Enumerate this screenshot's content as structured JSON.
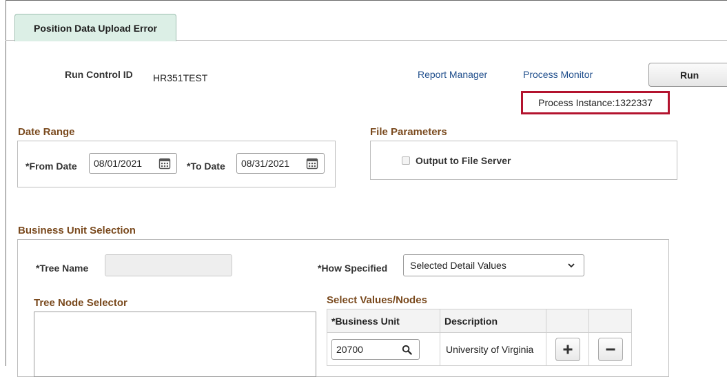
{
  "tab": {
    "label": "Position Data Upload Error"
  },
  "run_control": {
    "label": "Run Control ID",
    "value": "HR351TEST"
  },
  "links": {
    "report_manager": "Report Manager",
    "process_monitor": "Process Monitor"
  },
  "run_button": {
    "label": "Run"
  },
  "process_instance": {
    "text": "Process Instance:1322337"
  },
  "date_range": {
    "title": "Date Range",
    "from_label": "*From Date",
    "from_value": "08/01/2021",
    "to_label": "*To Date",
    "to_value": "08/31/2021"
  },
  "file_parameters": {
    "title": "File Parameters",
    "output_label": "Output to File Server",
    "output_checked": false
  },
  "business_unit_selection": {
    "title": "Business Unit Selection",
    "tree_name_label": "*Tree Name",
    "tree_name_value": "",
    "how_specified_label": "*How Specified",
    "how_specified_value": "Selected Detail Values",
    "tree_node_selector_title": "Tree Node Selector",
    "select_values_title": "Select Values/Nodes",
    "columns": [
      "*Business Unit",
      "Description"
    ],
    "rows": [
      {
        "business_unit": "20700",
        "description": "University of Virginia"
      }
    ]
  },
  "icons": {
    "calendar": "calendar-icon",
    "search": "search-icon",
    "chevron": "chevron-down-icon",
    "add": "plus-icon",
    "remove": "minus-icon"
  },
  "colors": {
    "highlight_border": "#b3132e",
    "section_title": "#7a4a1e",
    "link": "#1f4e8c",
    "tab_background": "#dcefe6"
  }
}
